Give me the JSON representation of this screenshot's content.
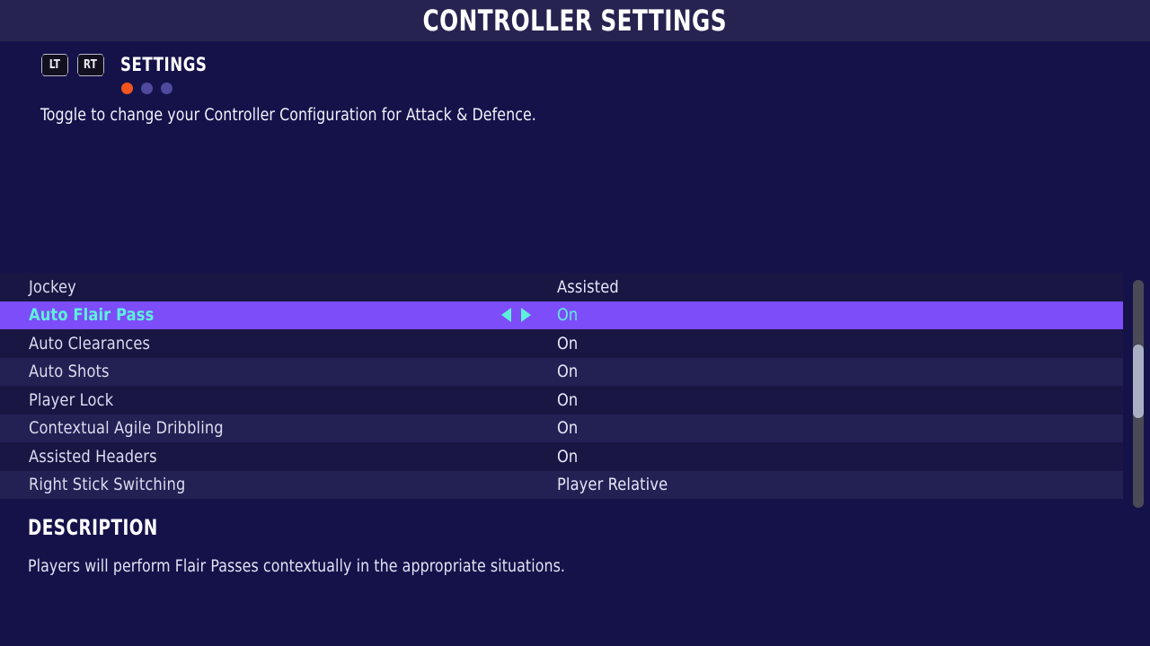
{
  "header": {
    "title": "CONTROLLER SETTINGS"
  },
  "tabs": {
    "left_bumper": "LT",
    "right_bumper": "RT",
    "active_label": "SETTINGS",
    "pages": [
      {
        "active": true,
        "color": "#f4551e"
      },
      {
        "active": false,
        "color": "#504a9e"
      },
      {
        "active": false,
        "color": "#504a9e"
      }
    ]
  },
  "subtitle": "Toggle to change your Controller Configuration for Attack & Defence.",
  "settings": {
    "rows": [
      {
        "label": "Jockey",
        "value": "Assisted",
        "selected": false
      },
      {
        "label": "Auto Flair Pass",
        "value": "On",
        "selected": true
      },
      {
        "label": "Auto Clearances",
        "value": "On",
        "selected": false
      },
      {
        "label": "Auto Shots",
        "value": "On",
        "selected": false
      },
      {
        "label": "Player Lock",
        "value": "On",
        "selected": false
      },
      {
        "label": "Contextual Agile Dribbling",
        "value": "On",
        "selected": false
      },
      {
        "label": "Assisted Headers",
        "value": "On",
        "selected": false
      },
      {
        "label": "Right Stick Switching",
        "value": "Player Relative",
        "selected": false
      }
    ]
  },
  "description": {
    "heading": "DESCRIPTION",
    "body": "Players will perform Flair Passes contextually in the appropriate situations."
  },
  "colors": {
    "background": "#15124a",
    "header_bar": "#272350",
    "row_odd": "#191644",
    "row_even": "#232053",
    "selection": "#7d4dfa",
    "selection_text": "#5ef0da",
    "label_text": "#dcdcf0",
    "scrollbar_track": "#4a4a57",
    "scrollbar_thumb": "#a9b0c4",
    "page_dot_active": "#f4551e",
    "page_dot_inactive": "#504a9e"
  }
}
